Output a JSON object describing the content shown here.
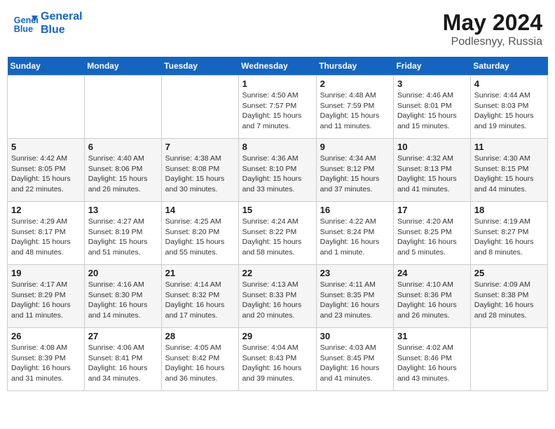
{
  "header": {
    "logo_line1": "General",
    "logo_line2": "Blue",
    "month": "May 2024",
    "location": "Podlesnyy, Russia"
  },
  "days_of_week": [
    "Sunday",
    "Monday",
    "Tuesday",
    "Wednesday",
    "Thursday",
    "Friday",
    "Saturday"
  ],
  "weeks": [
    [
      {
        "day": "",
        "info": ""
      },
      {
        "day": "",
        "info": ""
      },
      {
        "day": "",
        "info": ""
      },
      {
        "day": "1",
        "info": "Sunrise: 4:50 AM\nSunset: 7:57 PM\nDaylight: 15 hours\nand 7 minutes."
      },
      {
        "day": "2",
        "info": "Sunrise: 4:48 AM\nSunset: 7:59 PM\nDaylight: 15 hours\nand 11 minutes."
      },
      {
        "day": "3",
        "info": "Sunrise: 4:46 AM\nSunset: 8:01 PM\nDaylight: 15 hours\nand 15 minutes."
      },
      {
        "day": "4",
        "info": "Sunrise: 4:44 AM\nSunset: 8:03 PM\nDaylight: 15 hours\nand 19 minutes."
      }
    ],
    [
      {
        "day": "5",
        "info": "Sunrise: 4:42 AM\nSunset: 8:05 PM\nDaylight: 15 hours\nand 22 minutes."
      },
      {
        "day": "6",
        "info": "Sunrise: 4:40 AM\nSunset: 8:06 PM\nDaylight: 15 hours\nand 26 minutes."
      },
      {
        "day": "7",
        "info": "Sunrise: 4:38 AM\nSunset: 8:08 PM\nDaylight: 15 hours\nand 30 minutes."
      },
      {
        "day": "8",
        "info": "Sunrise: 4:36 AM\nSunset: 8:10 PM\nDaylight: 15 hours\nand 33 minutes."
      },
      {
        "day": "9",
        "info": "Sunrise: 4:34 AM\nSunset: 8:12 PM\nDaylight: 15 hours\nand 37 minutes."
      },
      {
        "day": "10",
        "info": "Sunrise: 4:32 AM\nSunset: 8:13 PM\nDaylight: 15 hours\nand 41 minutes."
      },
      {
        "day": "11",
        "info": "Sunrise: 4:30 AM\nSunset: 8:15 PM\nDaylight: 15 hours\nand 44 minutes."
      }
    ],
    [
      {
        "day": "12",
        "info": "Sunrise: 4:29 AM\nSunset: 8:17 PM\nDaylight: 15 hours\nand 48 minutes."
      },
      {
        "day": "13",
        "info": "Sunrise: 4:27 AM\nSunset: 8:19 PM\nDaylight: 15 hours\nand 51 minutes."
      },
      {
        "day": "14",
        "info": "Sunrise: 4:25 AM\nSunset: 8:20 PM\nDaylight: 15 hours\nand 55 minutes."
      },
      {
        "day": "15",
        "info": "Sunrise: 4:24 AM\nSunset: 8:22 PM\nDaylight: 15 hours\nand 58 minutes."
      },
      {
        "day": "16",
        "info": "Sunrise: 4:22 AM\nSunset: 8:24 PM\nDaylight: 16 hours\nand 1 minute."
      },
      {
        "day": "17",
        "info": "Sunrise: 4:20 AM\nSunset: 8:25 PM\nDaylight: 16 hours\nand 5 minutes."
      },
      {
        "day": "18",
        "info": "Sunrise: 4:19 AM\nSunset: 8:27 PM\nDaylight: 16 hours\nand 8 minutes."
      }
    ],
    [
      {
        "day": "19",
        "info": "Sunrise: 4:17 AM\nSunset: 8:29 PM\nDaylight: 16 hours\nand 11 minutes."
      },
      {
        "day": "20",
        "info": "Sunrise: 4:16 AM\nSunset: 8:30 PM\nDaylight: 16 hours\nand 14 minutes."
      },
      {
        "day": "21",
        "info": "Sunrise: 4:14 AM\nSunset: 8:32 PM\nDaylight: 16 hours\nand 17 minutes."
      },
      {
        "day": "22",
        "info": "Sunrise: 4:13 AM\nSunset: 8:33 PM\nDaylight: 16 hours\nand 20 minutes."
      },
      {
        "day": "23",
        "info": "Sunrise: 4:11 AM\nSunset: 8:35 PM\nDaylight: 16 hours\nand 23 minutes."
      },
      {
        "day": "24",
        "info": "Sunrise: 4:10 AM\nSunset: 8:36 PM\nDaylight: 16 hours\nand 26 minutes."
      },
      {
        "day": "25",
        "info": "Sunrise: 4:09 AM\nSunset: 8:38 PM\nDaylight: 16 hours\nand 28 minutes."
      }
    ],
    [
      {
        "day": "26",
        "info": "Sunrise: 4:08 AM\nSunset: 8:39 PM\nDaylight: 16 hours\nand 31 minutes."
      },
      {
        "day": "27",
        "info": "Sunrise: 4:06 AM\nSunset: 8:41 PM\nDaylight: 16 hours\nand 34 minutes."
      },
      {
        "day": "28",
        "info": "Sunrise: 4:05 AM\nSunset: 8:42 PM\nDaylight: 16 hours\nand 36 minutes."
      },
      {
        "day": "29",
        "info": "Sunrise: 4:04 AM\nSunset: 8:43 PM\nDaylight: 16 hours\nand 39 minutes."
      },
      {
        "day": "30",
        "info": "Sunrise: 4:03 AM\nSunset: 8:45 PM\nDaylight: 16 hours\nand 41 minutes."
      },
      {
        "day": "31",
        "info": "Sunrise: 4:02 AM\nSunset: 8:46 PM\nDaylight: 16 hours\nand 43 minutes."
      },
      {
        "day": "",
        "info": ""
      }
    ]
  ]
}
